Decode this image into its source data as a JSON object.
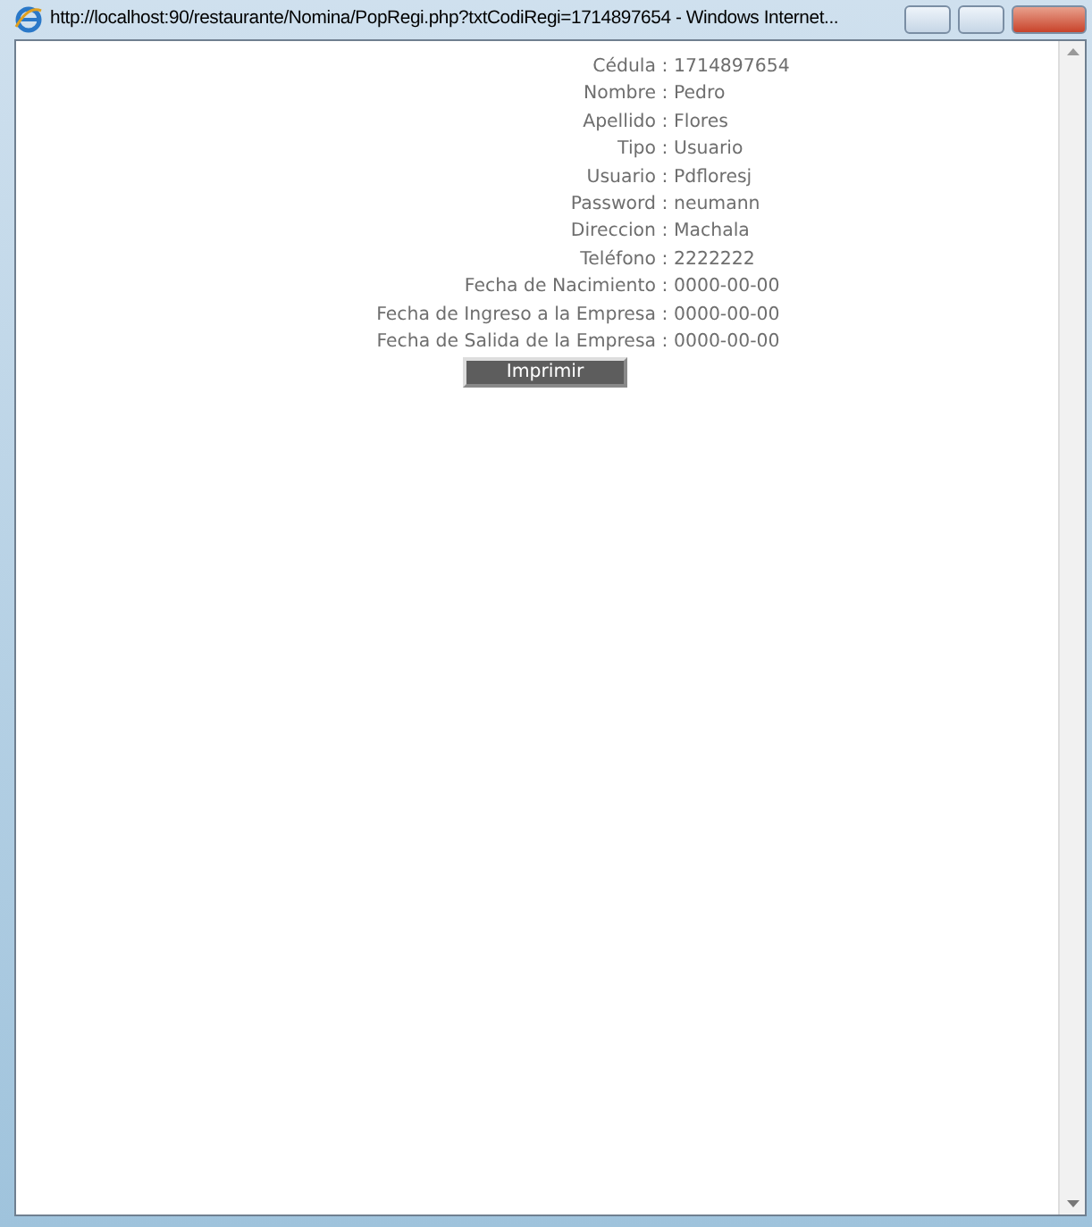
{
  "window": {
    "title": "http://localhost:90/restaurante/Nomina/PopRegi.php?txtCodiRegi=1714897654 - Windows Internet..."
  },
  "fields": [
    {
      "label": "Cédula",
      "separator": ":",
      "value": "1714897654"
    },
    {
      "label": "Nombre",
      "separator": ":",
      "value": "Pedro"
    },
    {
      "label": "Apellido",
      "separator": ":",
      "value": "Flores"
    },
    {
      "label": "Tipo",
      "separator": ":",
      "value": "Usuario"
    },
    {
      "label": "Usuario",
      "separator": ":",
      "value": "Pdfloresj"
    },
    {
      "label": "Password",
      "separator": ":",
      "value": "neumann"
    },
    {
      "label": "Direccion",
      "separator": ":",
      "value": "Machala"
    },
    {
      "label": "Teléfono",
      "separator": ":",
      "value": "2222222"
    },
    {
      "label": "Fecha de Nacimiento",
      "separator": ":",
      "value": "0000-00-00"
    },
    {
      "label": "Fecha de Ingreso a la Empresa",
      "separator": ":",
      "value": "0000-00-00"
    },
    {
      "label": "Fecha de Salida de la Empresa",
      "separator": ":",
      "value": "0000-00-00"
    }
  ],
  "print_button": {
    "label": "Imprimir"
  }
}
